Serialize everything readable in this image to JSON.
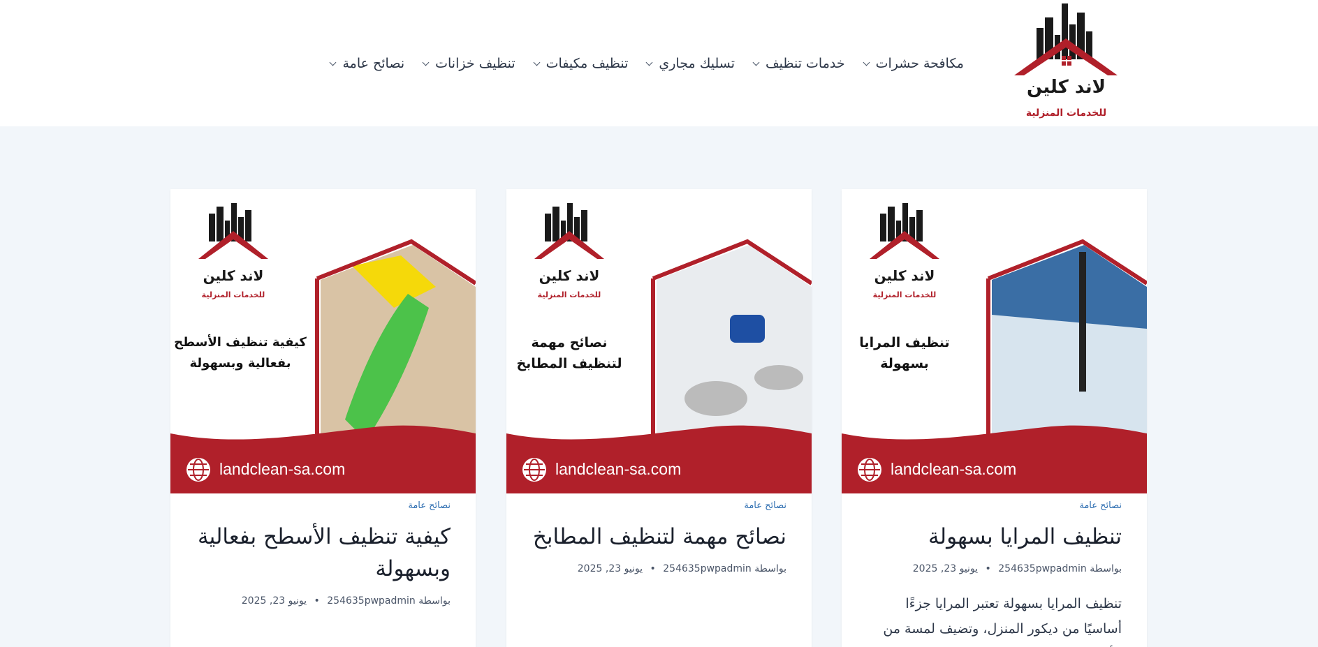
{
  "site": {
    "logo_name": "لاند كلين",
    "logo_tagline": "للخدمات المنزلية"
  },
  "nav": {
    "items": [
      {
        "label": "مكافحة حشرات"
      },
      {
        "label": "خدمات تنظيف"
      },
      {
        "label": "تسليك مجاري"
      },
      {
        "label": "تنظيف مكيفات"
      },
      {
        "label": "تنظيف خزانات"
      },
      {
        "label": "نصائح عامة"
      }
    ]
  },
  "colors": {
    "brand_red": "#b0202a",
    "link_blue": "#2b6cb0",
    "page_bg": "#f2f6fa"
  },
  "posts": [
    {
      "image_caption_line1": "تنظيف المرايا",
      "image_caption_line2": "بسهولة",
      "image_site": "landclean-sa.com",
      "category": "نصائح عامة",
      "title": "تنظيف المرايا بسهولة",
      "author_prefix": "بواسطة",
      "author": "254635pwpadmin",
      "date": "يونيو 23, 2025",
      "excerpt": "تنظيف المرايا بسهولة تعتبر المرايا جزءًا أساسيًا من ديكور المنزل، وتضيف لمسة من الأناقة"
    },
    {
      "image_caption_line1": "نصائح مهمة",
      "image_caption_line2": "لتنظيف المطابخ",
      "image_site": "landclean-sa.com",
      "category": "نصائح عامة",
      "title": "نصائح مهمة لتنظيف المطابخ",
      "author_prefix": "بواسطة",
      "author": "254635pwpadmin",
      "date": "يونيو 23, 2025"
    },
    {
      "image_caption_line1": "كيفية تنظيف الأسطح",
      "image_caption_line2": "بفعالية وبسهولة",
      "image_site": "landclean-sa.com",
      "category": "نصائح عامة",
      "title": "كيفية تنظيف الأسطح بفعالية وبسهولة",
      "author_prefix": "بواسطة",
      "author": "254635pwpadmin",
      "date": "يونيو 23, 2025"
    }
  ]
}
